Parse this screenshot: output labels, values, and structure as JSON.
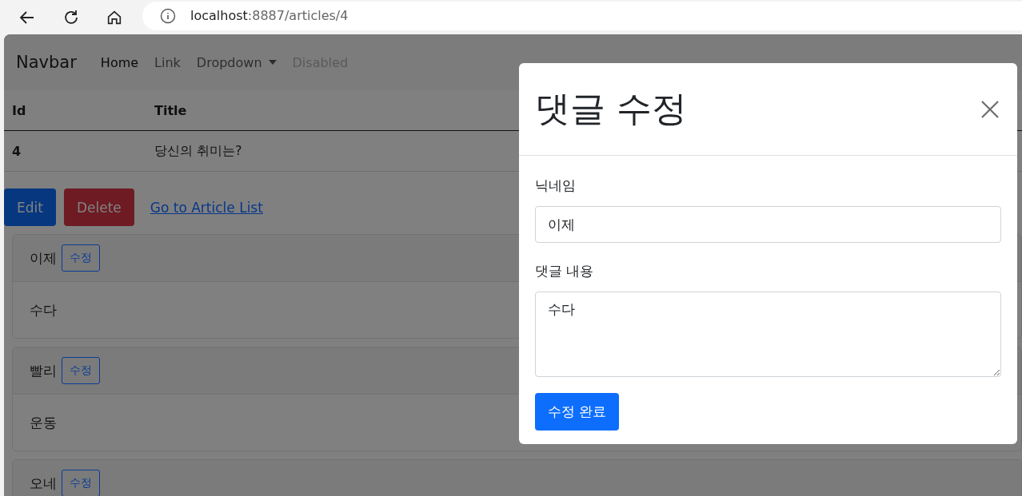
{
  "browser": {
    "url_host": "localhost",
    "url_path": ":8887/articles/4"
  },
  "navbar": {
    "brand": "Navbar",
    "items": [
      {
        "label": "Home",
        "kind": "link",
        "selected": true,
        "disabled": false
      },
      {
        "label": "Link",
        "kind": "link",
        "selected": false,
        "disabled": false
      },
      {
        "label": "Dropdown",
        "kind": "dropdown",
        "selected": false,
        "disabled": false
      },
      {
        "label": "Disabled",
        "kind": "link",
        "selected": false,
        "disabled": true
      }
    ]
  },
  "table": {
    "columns": [
      "Id",
      "Title"
    ],
    "rows": [
      [
        "4",
        "당신의 취미는?"
      ]
    ]
  },
  "actions": {
    "edit": "Edit",
    "delete": "Delete",
    "link": "Go to Article List"
  },
  "comments": [
    {
      "nickname": "이제",
      "button": "수정",
      "body": "수다"
    },
    {
      "nickname": "빨리",
      "button": "수정",
      "body": "운동"
    },
    {
      "nickname": "오네",
      "button": "수정"
    }
  ],
  "modal": {
    "title": "댓글 수정",
    "fields": [
      {
        "kind": "input",
        "label": "닉네임",
        "value": "이제"
      },
      {
        "kind": "textarea",
        "label": "댓글 내용",
        "value": "수다"
      }
    ],
    "submit": "수정 완료"
  }
}
